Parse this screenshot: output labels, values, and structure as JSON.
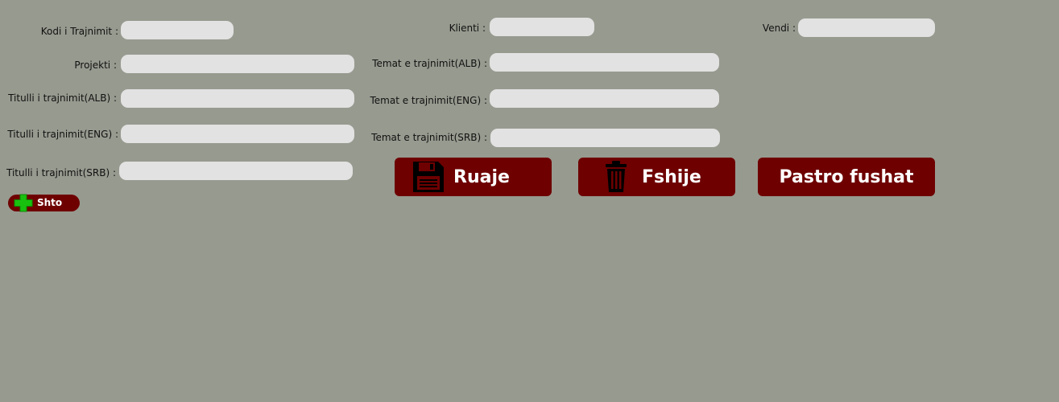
{
  "form": {
    "kodi_label": "Kodi i Trajnimit :",
    "projekti_label": "Projekti :",
    "titulli_alb_label": "Titulli i trajnimit(ALB) :",
    "titulli_eng_label": "Titulli i trajnimit(ENG) :",
    "titulli_srb_label": "Titulli i trajnimit(SRB) :",
    "klienti_label": "Klienti :",
    "temat_alb_label": "Temat e trajnimit(ALB) :",
    "temat_eng_label": "Temat e trajnimit(ENG) :",
    "temat_srb_label": "Temat e trajnimit(SRB) :",
    "vendi_label": "Vendi :"
  },
  "actions": {
    "add_label": "Shto",
    "save_label": "Ruaje",
    "delete_label": "Fshije",
    "clear_label": "Pastro fushat"
  },
  "icons": {
    "add": "plus-icon",
    "save": "floppy-disk-icon",
    "delete": "trash-icon"
  },
  "colors": {
    "background": "#979a8f",
    "input_bg": "#e2e2e2",
    "button_bg": "#6e0000",
    "add_icon": "#19c10f"
  }
}
